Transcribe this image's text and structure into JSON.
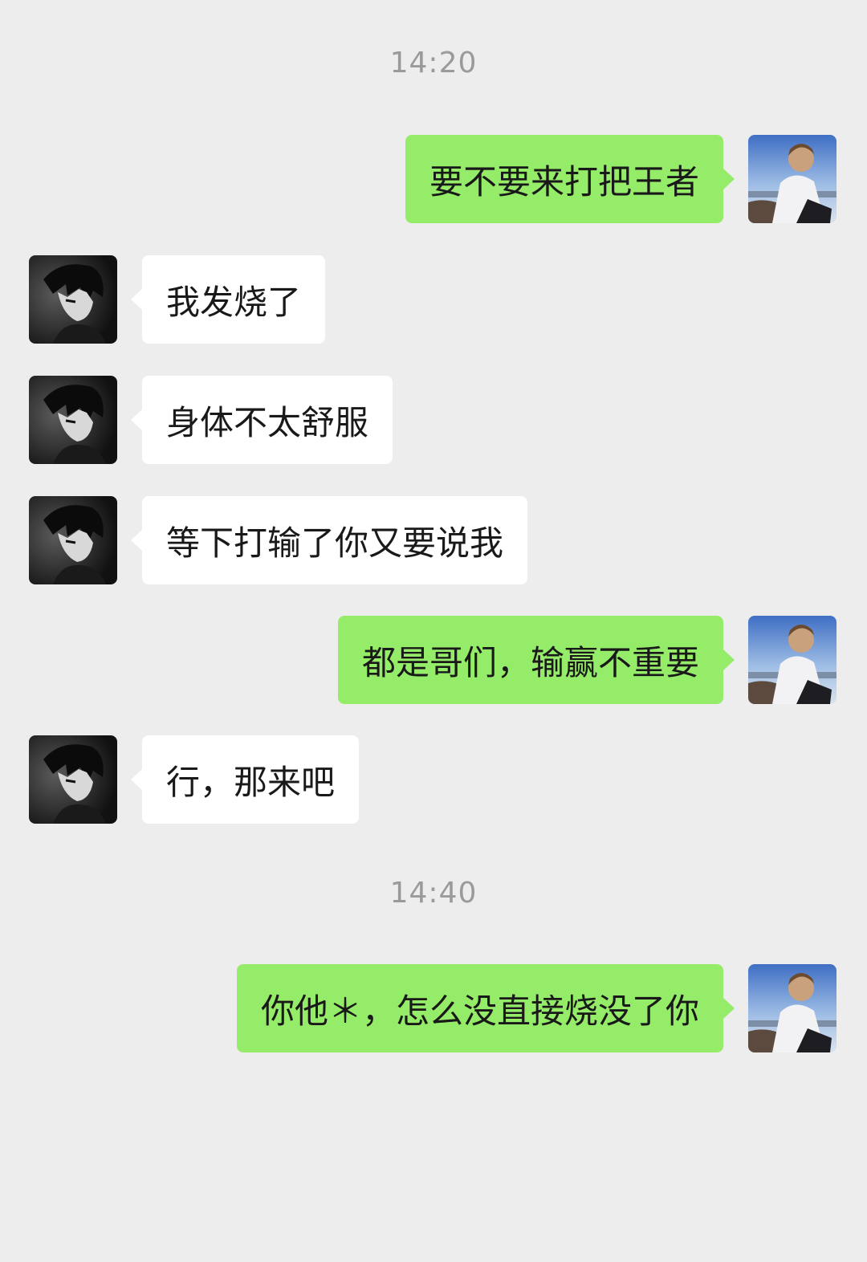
{
  "chat": {
    "timestamps": [
      "14:20",
      "14:40"
    ],
    "messages": [
      {
        "side": "me",
        "text": "要不要来打把王者",
        "avatar": "self-avatar-photo"
      },
      {
        "side": "friend",
        "text": "我发烧了",
        "avatar": "friend-avatar-anime"
      },
      {
        "side": "friend",
        "text": "身体不太舒服",
        "avatar": "friend-avatar-anime"
      },
      {
        "side": "friend",
        "text": "等下打输了你又要说我",
        "avatar": "friend-avatar-anime"
      },
      {
        "side": "me",
        "text": "都是哥们，输赢不重要",
        "avatar": "self-avatar-photo"
      },
      {
        "side": "friend",
        "text": "行，那来吧",
        "avatar": "friend-avatar-anime"
      },
      {
        "side": "me",
        "text": "你他＊，怎么没直接烧没了你",
        "avatar": "self-avatar-photo"
      }
    ]
  },
  "colors": {
    "background": "#ededed",
    "outgoing_bubble": "#95ec69",
    "incoming_bubble": "#ffffff",
    "timestamp_text": "#9a9a9a",
    "message_text": "#191919"
  }
}
